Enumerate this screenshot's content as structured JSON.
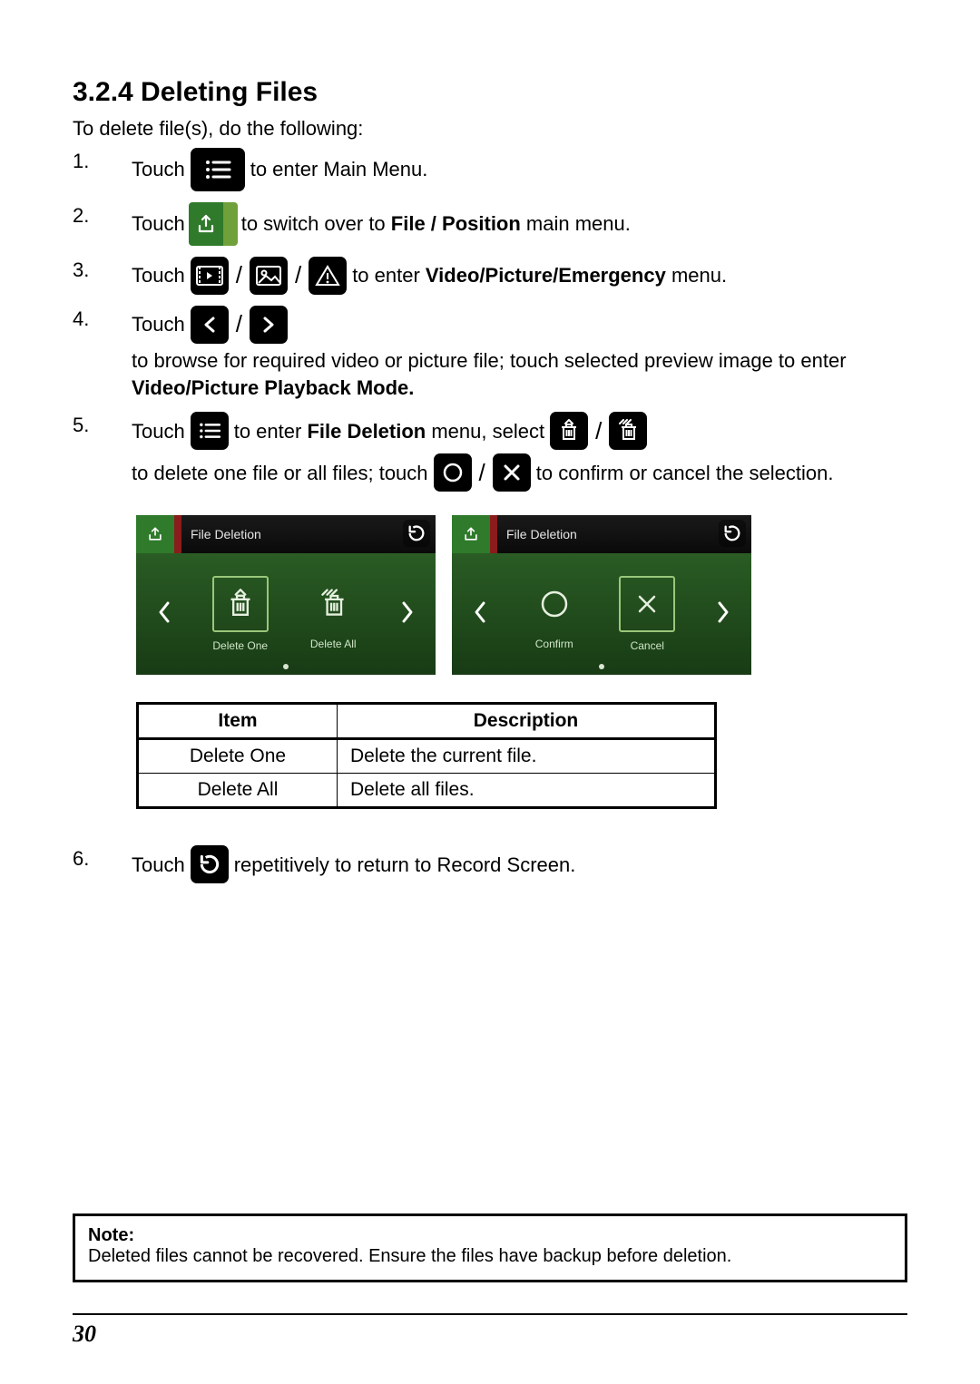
{
  "heading": "3.2.4   Deleting Files",
  "intro": "To delete file(s), do the following:",
  "steps": {
    "s1": {
      "num": "1.",
      "a": "Touch",
      "b": "to enter Main Menu."
    },
    "s2": {
      "num": "2.",
      "a": "Touch",
      "b": "to switch over to ",
      "bold": "File / Position",
      "c": " main menu."
    },
    "s3": {
      "num": "3.",
      "a": "Touch",
      "b": "to enter ",
      "bold": "Video/Picture/Emergency",
      "c": " menu."
    },
    "s4": {
      "num": "4.",
      "a": "Touch",
      "b": "to browse for required video or picture file; touch selected preview image to enter ",
      "bold": "Video/Picture Playback Mode."
    },
    "s5": {
      "num": "5.",
      "a": "Touch",
      "b": "to enter ",
      "bold": "File Deletion",
      "c": " menu, select",
      "d": "to delete one file or all files; touch",
      "e": "to confirm or cancel the selection."
    },
    "s6": {
      "num": "6.",
      "a": "Touch",
      "b": "repetitively to return to Record Screen."
    }
  },
  "shots": {
    "title": "File Deletion",
    "left": {
      "opt1": "Delete One",
      "opt2": "Delete All"
    },
    "right": {
      "opt1": "Confirm",
      "opt2": "Cancel"
    }
  },
  "table": {
    "h1": "Item",
    "h2": "Description",
    "r1c1": "Delete One",
    "r1c2": "Delete the current file.",
    "r2c1": "Delete All",
    "r2c2": "Delete all files."
  },
  "note": {
    "label": "Note:",
    "text": "Deleted files cannot be recovered. Ensure the files have backup before deletion."
  },
  "page_number": "30"
}
